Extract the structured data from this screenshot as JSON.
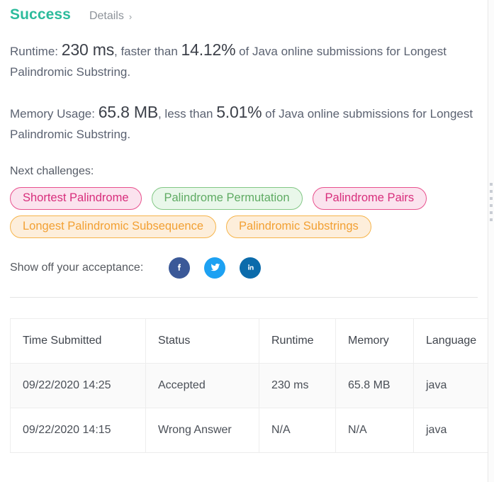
{
  "header": {
    "status_title": "Success",
    "details_label": "Details",
    "details_chevron": "›"
  },
  "results": {
    "runtime": {
      "prefix": "Runtime:",
      "value": "230 ms",
      "middle": ", faster than",
      "percent": "14.12%",
      "suffix": "of Java online submissions for Longest Palindromic Substring."
    },
    "memory": {
      "prefix": "Memory Usage:",
      "value": "65.8 MB",
      "middle": ", less than",
      "percent": "5.01%",
      "suffix": "of Java online submissions for Longest Palindromic Substring."
    }
  },
  "next_challenges": {
    "label": "Next challenges:",
    "rows": [
      [
        {
          "label": "Shortest Palindrome",
          "color": "pink"
        },
        {
          "label": "Palindrome Permutation",
          "color": "green"
        },
        {
          "label": "Palindrome Pairs",
          "color": "pink"
        }
      ],
      [
        {
          "label": "Longest Palindromic Subsequence",
          "color": "orange"
        },
        {
          "label": "Palindromic Substrings",
          "color": "orange"
        }
      ]
    ],
    "colors": {
      "pink_bg": "#fbe3ee",
      "pink_border": "#e8508d",
      "pink_text": "#d82e7c",
      "green_bg": "#e9f7ea",
      "green_border": "#82c785",
      "green_text": "#5fab63",
      "orange_bg": "#fdeedb",
      "orange_border": "#f6b44a",
      "orange_text": "#f2a033"
    }
  },
  "share": {
    "label": "Show off your acceptance:",
    "icons": [
      {
        "name": "facebook-icon",
        "color": "#3b5998"
      },
      {
        "name": "twitter-icon",
        "color": "#1da1f2"
      },
      {
        "name": "linkedin-icon",
        "color": "#0b6bab"
      }
    ]
  },
  "submissions_table": {
    "columns": [
      "Time Submitted",
      "Status",
      "Runtime",
      "Memory",
      "Language"
    ],
    "rows": [
      {
        "time": "09/22/2020 14:25",
        "status": "Accepted",
        "status_kind": "accepted",
        "runtime": "230 ms",
        "memory": "65.8 MB",
        "language": "java"
      },
      {
        "time": "09/22/2020 14:15",
        "status": "Wrong Answer",
        "status_kind": "wrong",
        "runtime": "N/A",
        "memory": "N/A",
        "language": "java"
      }
    ],
    "status_colors": {
      "accepted": "#2cbb9c",
      "wrong": "#ef4743"
    }
  },
  "theme": {
    "success_green": "#2cbb9c",
    "body_text": "#5b6271"
  }
}
